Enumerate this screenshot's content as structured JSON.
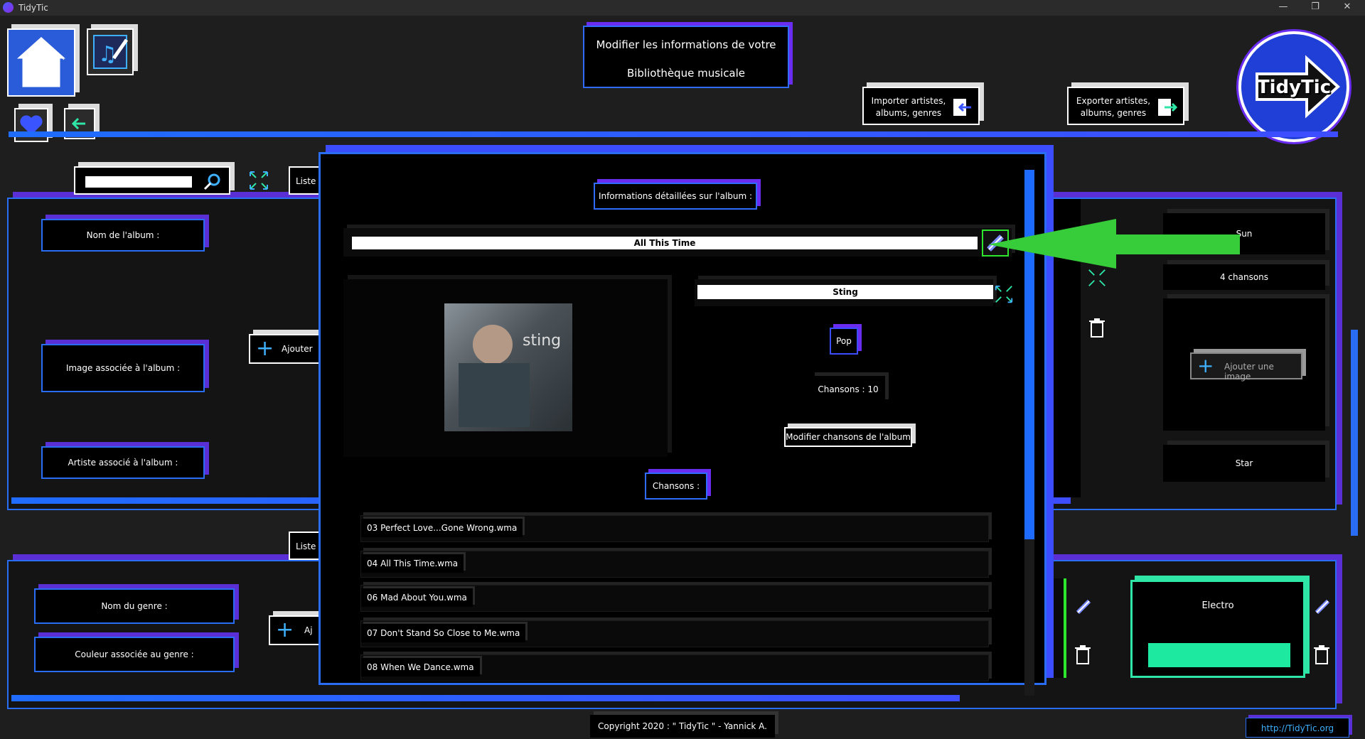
{
  "window": {
    "title": "TidyTic",
    "minimize": "—",
    "restore": "❐",
    "close": "✕"
  },
  "header": {
    "title_line1": "Modifier les informations de votre",
    "title_line2": "Bibliothèque musicale",
    "import_label": "Importer artistes, albums, genres",
    "export_label": "Exporter artistes, albums, genres",
    "logo_text": "TidyTic"
  },
  "albums_panel": {
    "tab_label": "Liste",
    "name_label": "Nom de l'album :",
    "image_label": "Image associée à l'album :",
    "artist_label": "Artiste associé à l'album :",
    "add_label": "Ajouter",
    "right_card_name": "Sun",
    "right_card_count": "4 chansons",
    "right_card_add_image": "Ajouter une image",
    "right_card_artist": "Star"
  },
  "genres_panel": {
    "tab_label": "Liste",
    "name_label": "Nom du genre :",
    "color_label": "Couleur associée au genre :",
    "add_label": "Aj",
    "genre_name": "Electro",
    "genre_color": "#1de9a0"
  },
  "modal": {
    "header": "Informations détaillées sur l'album :",
    "album_title": "All This Time",
    "artist": "Sting",
    "genre": "Pop",
    "songs_count": "Chansons  : 10",
    "edit_songs": "Modifier chansons de l'album",
    "songs_header": "Chansons  :",
    "songs": [
      "03 Perfect Love...Gone Wrong.wma",
      "04 All This Time.wma",
      "06 Mad About You.wma",
      "07 Don't Stand So Close to Me.wma",
      "08 When We Dance.wma"
    ],
    "cover_text": "sting"
  },
  "footer": {
    "copyright": "Copyright 2020 : \" TidyTic \" - Yannick A.",
    "link": "http://TidyTic.org"
  },
  "colors": {
    "accent_blue": "#2a6df5",
    "accent_purple": "#5a2fd6",
    "arrow_green": "#33cc33",
    "genre_green": "#1de9a0"
  }
}
